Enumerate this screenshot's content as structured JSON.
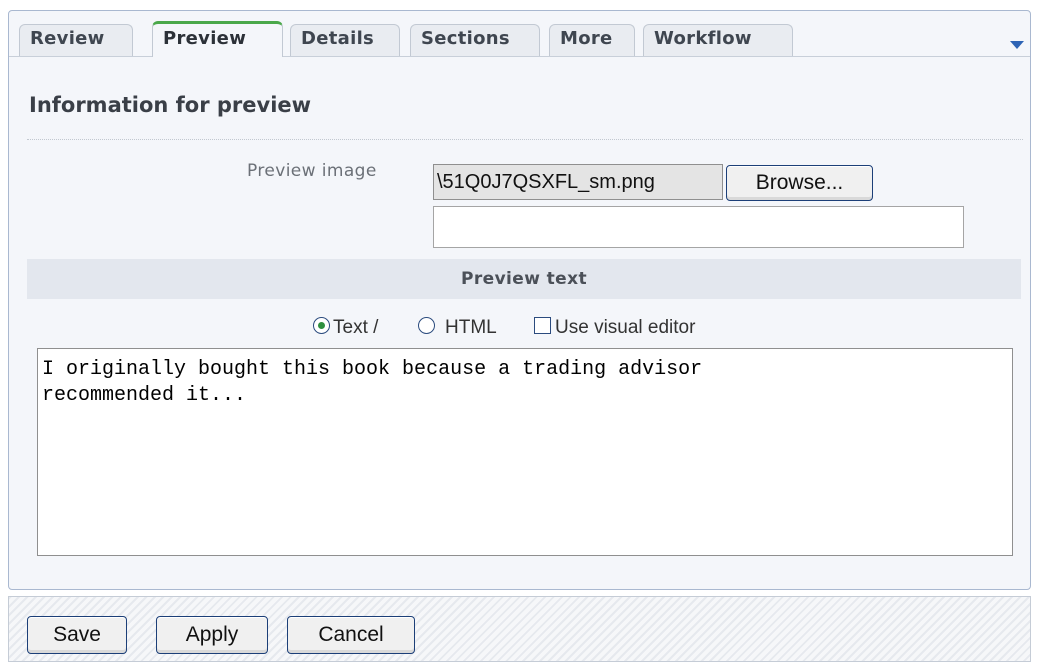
{
  "tabs": [
    {
      "label": "Review",
      "active": false
    },
    {
      "label": "Preview",
      "active": true
    },
    {
      "label": "Details",
      "active": false
    },
    {
      "label": "Sections",
      "active": false
    },
    {
      "label": "More",
      "active": false
    },
    {
      "label": "Workflow",
      "active": false
    }
  ],
  "header": {
    "menu_icon": "chevron-down-icon"
  },
  "section": {
    "title": "Information for preview"
  },
  "preview_image": {
    "label": "Preview image",
    "file_value": "\\51Q0J7QSXFL_sm.png",
    "browse_label": "Browse...",
    "extra_input_value": ""
  },
  "preview_text": {
    "band_label": "Preview text",
    "options": {
      "text_label": "Text /",
      "html_label": "HTML",
      "visual_editor_label": "Use visual editor",
      "selected": "Text",
      "visual_editor_checked": false
    },
    "content": "I originally bought this book because a trading advisor\nrecommended it..."
  },
  "footer": {
    "save_label": "Save",
    "apply_label": "Apply",
    "cancel_label": "Cancel"
  },
  "colors": {
    "active_tab_accent": "#4aa84a",
    "link_blue": "#2e64b5",
    "band_bg": "#e3e7ee"
  }
}
